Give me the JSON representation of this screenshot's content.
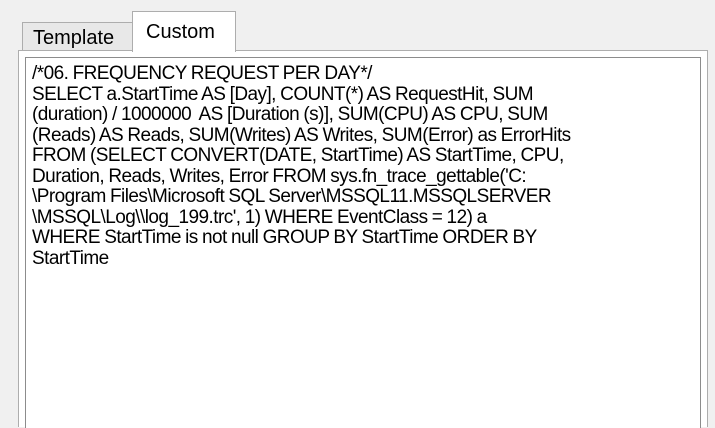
{
  "tabs": [
    {
      "label": "Template",
      "active": false
    },
    {
      "label": "Custom",
      "active": true
    }
  ],
  "editor": {
    "lines": [
      "/*06. FREQUENCY REQUEST PER DAY*/",
      "SELECT a.StartTime AS [Day], COUNT(*) AS RequestHit, SUM",
      "(duration) / 1000000  AS [Duration (s)], SUM(CPU) AS CPU, SUM",
      "(Reads) AS Reads, SUM(Writes) AS Writes, SUM(Error) as ErrorHits",
      "FROM (SELECT CONVERT(DATE, StartTime) AS StartTime, CPU,",
      "Duration, Reads, Writes, Error FROM sys.fn_trace_gettable('C:",
      "\\Program Files\\Microsoft SQL Server\\MSSQL11.MSSQLSERVER",
      "\\MSSQL\\Log\\\\log_199.trc', 1) WHERE EventClass = 12) a",
      "WHERE StartTime is not null GROUP BY StartTime ORDER BY",
      "StartTime"
    ]
  },
  "colors": {
    "window_bg": "#f0f0f0",
    "panel_bg": "#ffffff",
    "border": "#adadad"
  }
}
